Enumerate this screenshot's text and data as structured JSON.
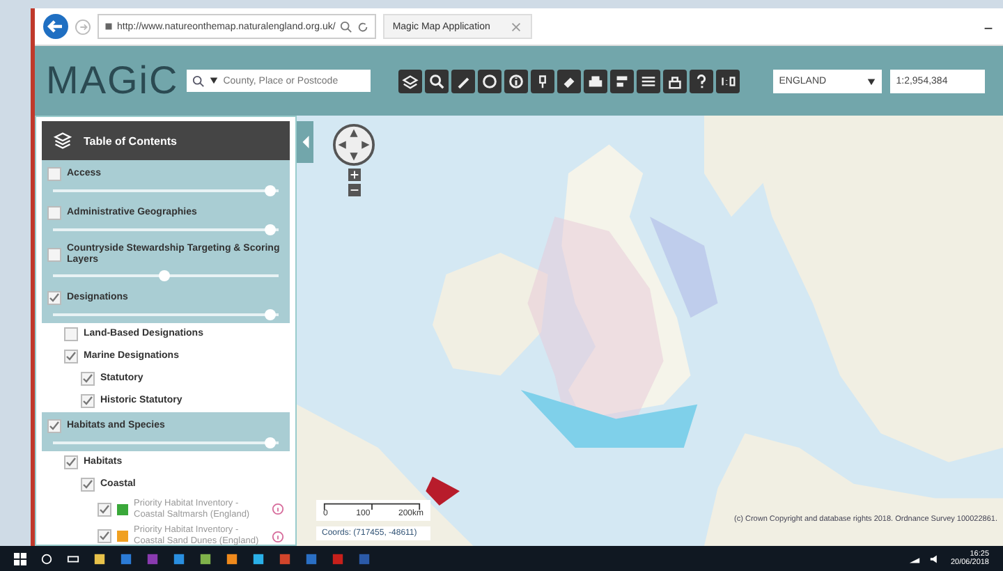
{
  "browser": {
    "url": "http://www.natureonthemap.naturalengland.org.uk/",
    "tab_title": "Magic Map Application"
  },
  "header": {
    "logo": "MAGiC",
    "search": {
      "placeholder": "County, Place or Postcode"
    },
    "region": {
      "value": "ENGLAND"
    },
    "scale": {
      "value": "1:2,954,384"
    }
  },
  "toc": {
    "title": "Table of Contents",
    "items": [
      {
        "label": "Access",
        "checked": false,
        "level": 0.97
      },
      {
        "label": "Administrative Geographies",
        "checked": false,
        "level": 0.97
      },
      {
        "label": "Countryside Stewardship Targeting & Scoring Layers",
        "checked": false,
        "level": 0.5
      },
      {
        "label": "Designations",
        "checked": true,
        "level": 0.97,
        "children": [
          {
            "label": "Land-Based Designations",
            "checked": false
          },
          {
            "label": "Marine Designations",
            "checked": true,
            "children": [
              {
                "label": "Statutory",
                "checked": true
              },
              {
                "label": "Historic Statutory",
                "checked": true
              }
            ]
          }
        ]
      },
      {
        "label": "Habitats and Species",
        "checked": true,
        "level": 0.97,
        "children": [
          {
            "label": "Habitats",
            "checked": true,
            "children": [
              {
                "label": "Coastal",
                "checked": true,
                "children": [
                  {
                    "label": "Priority Habitat Inventory - Coastal Saltmarsh (England)",
                    "checked": true,
                    "color": "#3aa83a"
                  },
                  {
                    "label": "Priority Habitat Inventory - Coastal Sand Dunes (England)",
                    "checked": true,
                    "color": "#f0a020"
                  }
                ]
              }
            ]
          }
        ]
      }
    ]
  },
  "map": {
    "scale_labels": [
      "0",
      "100",
      "200km"
    ],
    "coordinates": "Coords: (717455, -48611)",
    "copyright": "(c) Crown Copyright and database rights 2018. Ordnance Survey 100022861."
  },
  "taskbar": {
    "time": "16:25",
    "date": "20/06/2018"
  }
}
